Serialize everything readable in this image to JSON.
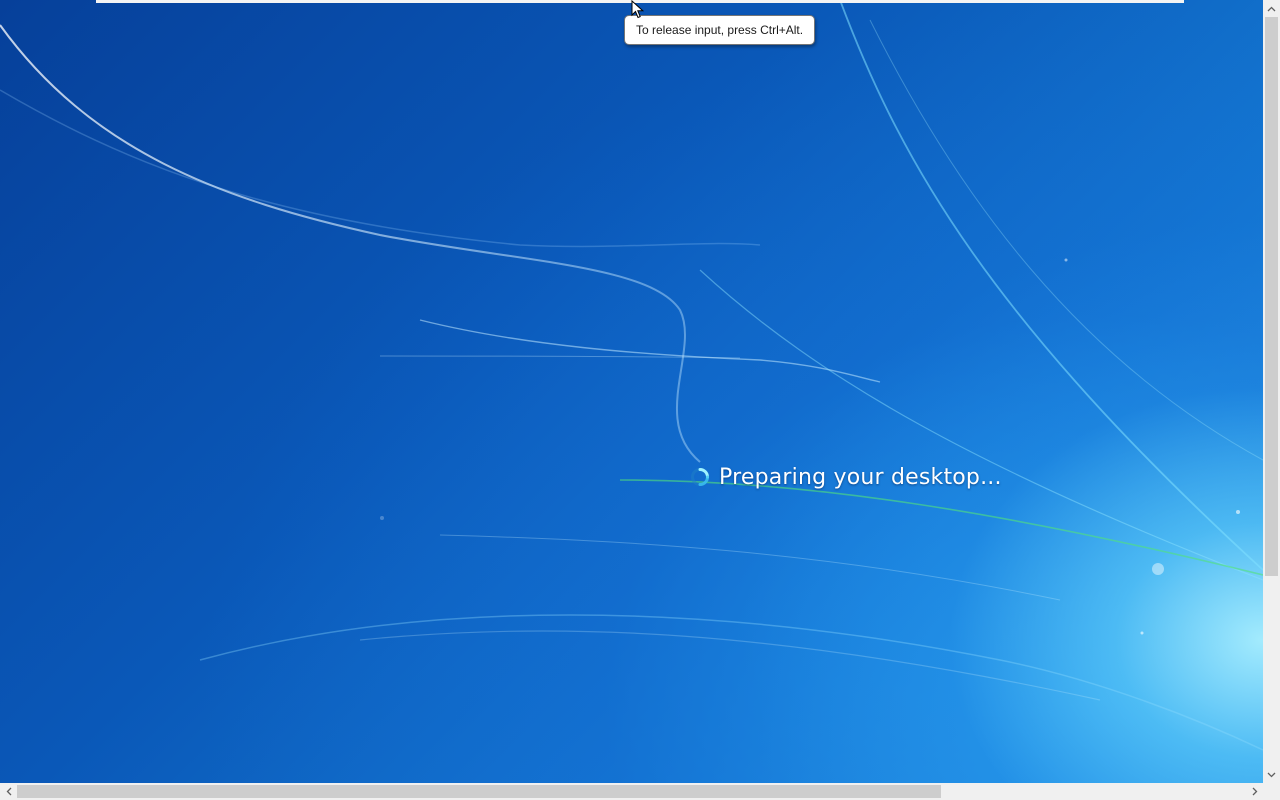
{
  "tooltip": {
    "text": "To release input, press Ctrl+Alt."
  },
  "status": {
    "message": "Preparing your desktop..."
  },
  "icons": {
    "cursor": "mouse-pointer",
    "spinner": "busy-spinner",
    "scroll_up": "chevron-up",
    "scroll_down": "chevron-down",
    "scroll_left": "chevron-left",
    "scroll_right": "chevron-right"
  },
  "colors": {
    "wallpaper_dark": "#06409a",
    "wallpaper_light": "#5fcdfa",
    "text": "#ffffff",
    "scrollbar_track": "#f0f0f0",
    "scrollbar_thumb": "#cdcdcd"
  }
}
